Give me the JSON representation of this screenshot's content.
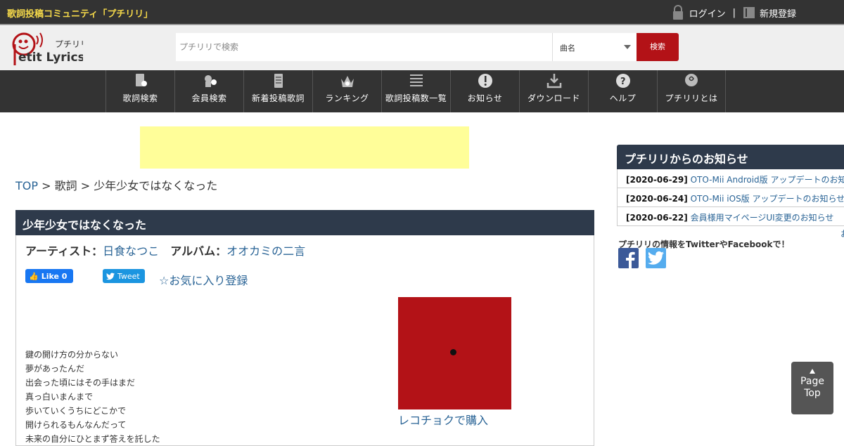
{
  "topbar": {
    "site_title": "歌詞投稿コミュニティ「プチリリ」",
    "login_label": "ログイン",
    "separator": "|",
    "register_label": "新規登録"
  },
  "header": {
    "search_placeholder": "プチリリで検索",
    "search_type": "曲名",
    "search_button": "検索",
    "logo_kana": "プチリリ",
    "logo_text": "etit Lyrics"
  },
  "nav": {
    "items": [
      {
        "label": "歌詞検索",
        "icon": "lyrics-search-icon"
      },
      {
        "label": "会員検索",
        "icon": "member-search-icon"
      },
      {
        "label": "新着投稿歌詞",
        "icon": "new-lyrics-icon"
      },
      {
        "label": "ランキング",
        "icon": "crown-icon"
      },
      {
        "label": "歌詞投稿数一覧",
        "icon": "list-icon"
      },
      {
        "label": "お知らせ",
        "icon": "exclamation-icon"
      },
      {
        "label": "ダウンロード",
        "icon": "download-icon"
      },
      {
        "label": "ヘルプ",
        "icon": "question-icon"
      },
      {
        "label": "プチリリとは",
        "icon": "petitlyrics-icon"
      }
    ]
  },
  "breadcrumb": {
    "top": "TOP",
    "sep1": " > ",
    "lyrics": "歌詞",
    "sep2": " > ",
    "current": "少年少女ではなくなった"
  },
  "song": {
    "title": "少年少女ではなくなった",
    "artist_label": "アーティスト：",
    "artist": "日食なつこ",
    "album_label": "アルバム：",
    "album": "オオカミの二言",
    "like_label": "Like 0",
    "tweet_label": "Tweet",
    "favorite_label": "☆お気に入り登録",
    "buy_label": "レコチョクで購入",
    "lyrics": [
      "鍵の開け方の分からない",
      "夢があったんだ",
      "出会った頃にはその手はまだ",
      "真っ白いまんまで",
      "歩いていくうちにどこかで",
      "開けられるもんなんだって",
      "未来の自分にひとまず答えを託した"
    ]
  },
  "news": {
    "heading": "プチリリからのお知らせ",
    "items": [
      {
        "date": "[2020-06-29]",
        "text": "OTO-Mii Android版 アップデートのお知らせ"
      },
      {
        "date": "[2020-06-24]",
        "text": "OTO-Mii iOS版 アップデートのお知らせ"
      },
      {
        "date": "[2020-06-22]",
        "text": "会員様用マイページUI変更のお知らせ"
      }
    ],
    "more": "お",
    "sns_text": "プチリリの情報をTwitterやFacebookで！"
  },
  "page_top": {
    "line1": "Page",
    "line2": "Top"
  },
  "colors": {
    "accent": "#b31217",
    "header_dark": "#2e3a4b",
    "link": "#2a6496",
    "title_yellow": "#f5d94a"
  }
}
